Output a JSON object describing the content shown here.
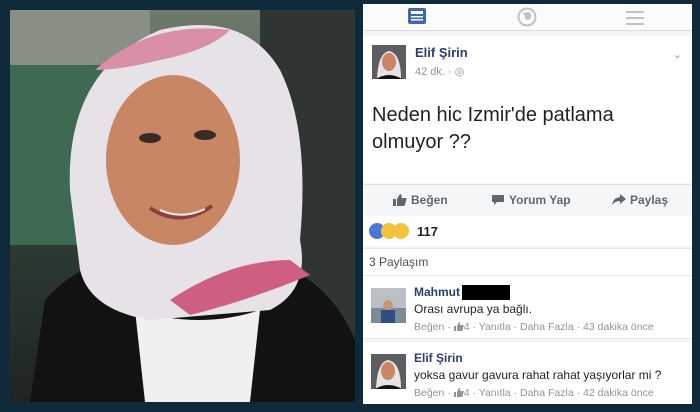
{
  "post": {
    "author": "Elif Şirin",
    "time": "42 dk. ·",
    "text": "Neden hic Izmir'de patlama olmuyor ??"
  },
  "actions": {
    "like": "Beğen",
    "comment": "Yorum Yap",
    "share": "Paylaş"
  },
  "reactions": {
    "count": "117",
    "icons": [
      "like-reaction-icon",
      "haha-reaction-icon",
      "wow-reaction-icon"
    ]
  },
  "shares": "3 Paylaşım",
  "comments": [
    {
      "author": "Mahmut",
      "text": "Orası avrupa ya bağlı.",
      "like": "Beğen",
      "likes": "4",
      "reply": "Yanıtla",
      "more": "Daha Fazla",
      "time": "43 dakika önce"
    },
    {
      "author": "Elif Şirin",
      "text": "yoksa gavur gavura rahat rahat yaşıyorlar mi ?",
      "like": "Beğen",
      "likes": "4",
      "reply": "Yanıtla",
      "more": "Daha Fazla",
      "time": "42 dakika önce"
    }
  ],
  "colors": {
    "frame": "#0f2a3a",
    "name_blue": "#2a3f6d",
    "like_blue": "#4a76d4",
    "meta_gray": "#90949c"
  }
}
